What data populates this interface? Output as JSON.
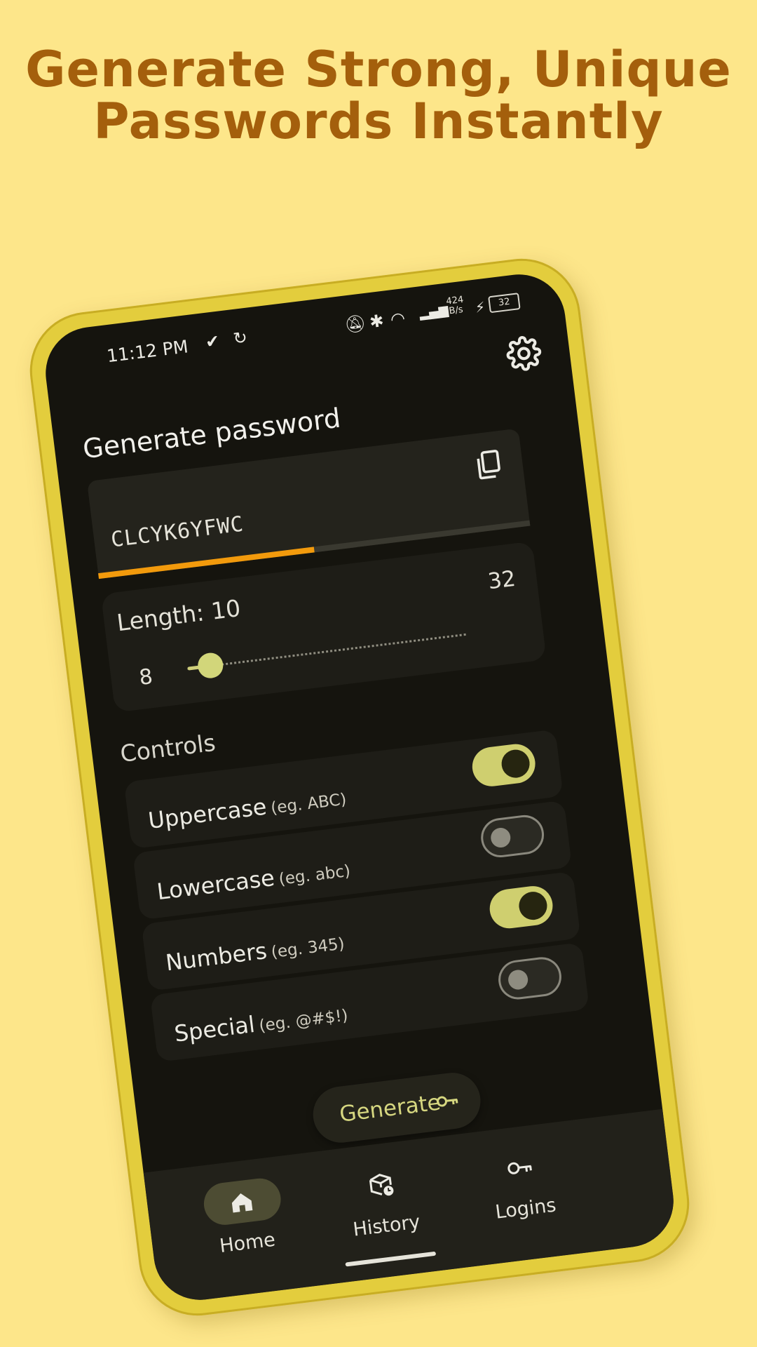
{
  "promo": {
    "line1": "Generate Strong, Unique",
    "line2": "Passwords Instantly"
  },
  "status_bar": {
    "time": "11:12 PM",
    "net_speed": "424",
    "net_unit": "B/s",
    "battery": "32"
  },
  "header": {
    "title": "Generate password",
    "settings_icon": "gear-icon"
  },
  "password": {
    "value": "CLCYK6YFWC",
    "strength": 0.5,
    "strength_color": "#f29a0c",
    "copy_icon": "copy-icon"
  },
  "length": {
    "label": "Length: 10",
    "min": "8",
    "max": "32",
    "value": 10,
    "min_value": 8,
    "max_value": 32
  },
  "controls": {
    "label": "Controls",
    "items": [
      {
        "name": "Uppercase",
        "example": "(eg. ABC)",
        "enabled": true
      },
      {
        "name": "Lowercase",
        "example": "(eg. abc)",
        "enabled": false
      },
      {
        "name": "Numbers",
        "example": "(eg. 345)",
        "enabled": true
      },
      {
        "name": "Special",
        "example": "(eg. @#$!)",
        "enabled": false
      }
    ]
  },
  "generate_button": {
    "label": "Generate",
    "icon": "key-icon"
  },
  "nav": {
    "items": [
      {
        "label": "Home",
        "icon": "home-icon",
        "active": true
      },
      {
        "label": "History",
        "icon": "history-icon",
        "active": false
      },
      {
        "label": "Logins",
        "icon": "key-icon",
        "active": false
      }
    ]
  },
  "colors": {
    "background": "#fde68a",
    "headline": "#a45f0c",
    "phone_frame": "#e3cd3d",
    "screen": "#15140e",
    "accent": "#cfcf6f"
  }
}
